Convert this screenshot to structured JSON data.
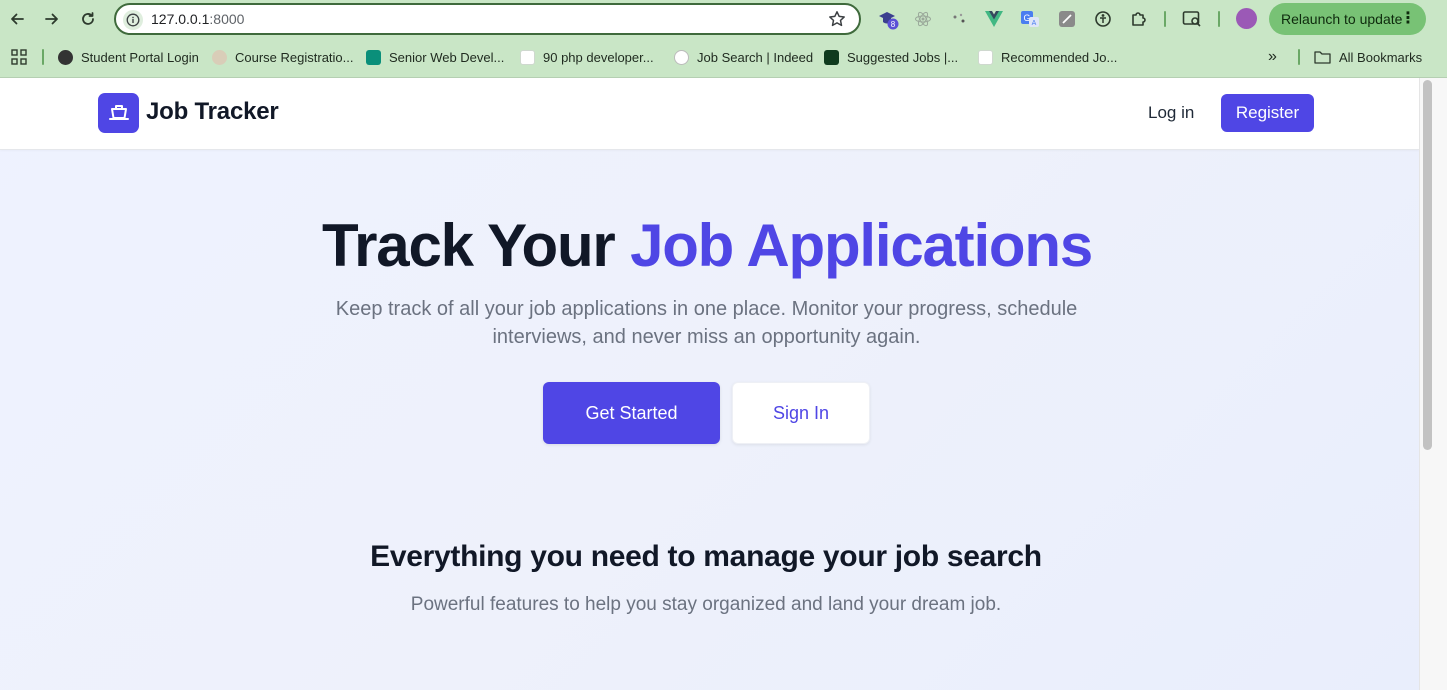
{
  "browser": {
    "url_host": "127.0.0.1",
    "url_port": ":8000",
    "extension_badge": "8",
    "relaunch_label": "Relaunch to update",
    "bookmarks": [
      {
        "label": "Student Portal Login"
      },
      {
        "label": "Course Registratio..."
      },
      {
        "label": "Senior Web Devel..."
      },
      {
        "label": "90 php developer..."
      },
      {
        "label": "Job Search | Indeed"
      },
      {
        "label": "Suggested Jobs |..."
      },
      {
        "label": "Recommended Jo..."
      }
    ],
    "bookmarks_overflow": "»",
    "all_bookmarks": "All Bookmarks"
  },
  "site": {
    "brand": "Job Tracker",
    "nav": {
      "login": "Log in",
      "register": "Register"
    },
    "hero": {
      "title_plain": "Track Your ",
      "title_accent": "Job Applications",
      "subtitle": "Keep track of all your job applications in one place. Monitor your progress, schedule interviews, and never miss an opportunity again.",
      "primary_cta": "Get Started",
      "secondary_cta": "Sign In"
    },
    "features": {
      "title": "Everything you need to manage your job search",
      "subtitle": "Powerful features to help you stay organized and land your dream job."
    }
  },
  "colors": {
    "accent": "#4f46e5",
    "chrome_green": "#c9e6c6",
    "heading": "#111827",
    "muted": "#6b7280"
  }
}
